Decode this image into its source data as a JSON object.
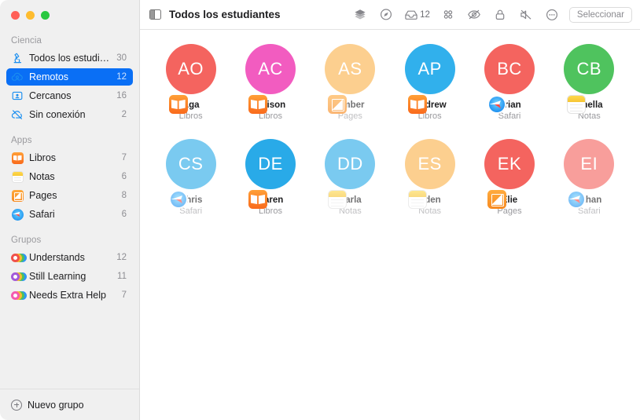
{
  "window": {
    "traffic_lights": [
      "close",
      "minimize",
      "zoom"
    ],
    "accent_color": "#0a6ff5"
  },
  "sidebar": {
    "sections": [
      {
        "header": "Ciencia",
        "items": [
          {
            "icon": "microscope-icon",
            "label": "Todos los estudiantes",
            "count": "30",
            "selected": false
          },
          {
            "icon": "cloud-person-icon",
            "label": "Remotos",
            "count": "12",
            "selected": true
          },
          {
            "icon": "person-card-icon",
            "label": "Cercanos",
            "count": "16",
            "selected": false
          },
          {
            "icon": "cloud-slash-icon",
            "label": "Sin conexión",
            "count": "2",
            "selected": false
          }
        ]
      },
      {
        "header": "Apps",
        "items": [
          {
            "icon": "books-app-icon",
            "label": "Libros",
            "count": "7",
            "selected": false
          },
          {
            "icon": "notes-app-icon",
            "label": "Notas",
            "count": "6",
            "selected": false
          },
          {
            "icon": "pages-app-icon",
            "label": "Pages",
            "count": "8",
            "selected": false
          },
          {
            "icon": "safari-app-icon",
            "label": "Safari",
            "count": "6",
            "selected": false
          }
        ]
      },
      {
        "header": "Grupos",
        "items": [
          {
            "icon": "group-icon",
            "label": "Understands",
            "count": "12",
            "selected": false,
            "dot_color": "#f0504a"
          },
          {
            "icon": "group-icon",
            "label": "Still Learning",
            "count": "11",
            "selected": false,
            "dot_color": "#a259d9"
          },
          {
            "icon": "group-icon",
            "label": "Needs Extra Help",
            "count": "7",
            "selected": false,
            "dot_color": "#f45ab0"
          }
        ]
      }
    ],
    "footer": {
      "icon": "plus-circle-icon",
      "label": "Nuevo grupo"
    }
  },
  "toolbar": {
    "sidebar_toggle_icon": "sidebar-toggle-icon",
    "title": "Todos los estudiantes",
    "buttons": [
      {
        "icon": "layers-icon",
        "label": ""
      },
      {
        "icon": "navigate-icon",
        "label": ""
      },
      {
        "icon": "inbox-icon",
        "label": "12"
      },
      {
        "icon": "grid-apps-icon",
        "label": ""
      },
      {
        "icon": "hide-screen-icon",
        "label": ""
      },
      {
        "icon": "lock-icon",
        "label": ""
      },
      {
        "icon": "mute-icon",
        "label": ""
      },
      {
        "icon": "more-icon",
        "label": ""
      }
    ],
    "select_label": "Seleccionar"
  },
  "students": [
    {
      "initials": "AO",
      "name": "Aga",
      "app": "Libros",
      "color": "#f4645f",
      "badge": "books-badge",
      "dimmed": false
    },
    {
      "initials": "AC",
      "name": "Allison",
      "app": "Libros",
      "color": "#f25cc0",
      "badge": "books-badge",
      "dimmed": false
    },
    {
      "initials": "AS",
      "name": "Amber",
      "app": "Pages",
      "color": "#fbb34c",
      "badge": "pages-badge",
      "dimmed": true
    },
    {
      "initials": "AP",
      "name": "Andrew",
      "app": "Libros",
      "color": "#31b0ec",
      "badge": "books-badge",
      "dimmed": false
    },
    {
      "initials": "BC",
      "name": "Brian",
      "app": "Safari",
      "color": "#f4645f",
      "badge": "safari-badge",
      "dimmed": false
    },
    {
      "initials": "CB",
      "name": "Chella",
      "app": "Notas",
      "color": "#4fc35e",
      "badge": "notes-badge",
      "dimmed": false
    },
    {
      "initials": "CS",
      "name": "Chris",
      "app": "Safari",
      "color": "#29aae8",
      "badge": "safari-badge",
      "dimmed": true
    },
    {
      "initials": "DE",
      "name": "Daren",
      "app": "Libros",
      "color": "#29aae8",
      "badge": "books-badge",
      "dimmed": false
    },
    {
      "initials": "DD",
      "name": "Darla",
      "app": "Notas",
      "color": "#29aae8",
      "badge": "notes-badge",
      "dimmed": true
    },
    {
      "initials": "ES",
      "name": "Eden",
      "app": "Notas",
      "color": "#fbb34c",
      "badge": "notes-badge",
      "dimmed": true
    },
    {
      "initials": "EK",
      "name": "Elie",
      "app": "Pages",
      "color": "#f4645f",
      "badge": "pages-badge",
      "dimmed": false
    },
    {
      "initials": "EI",
      "name": "Ethan",
      "app": "Safari",
      "color": "#f4645f",
      "badge": "safari-badge",
      "dimmed": true
    }
  ]
}
